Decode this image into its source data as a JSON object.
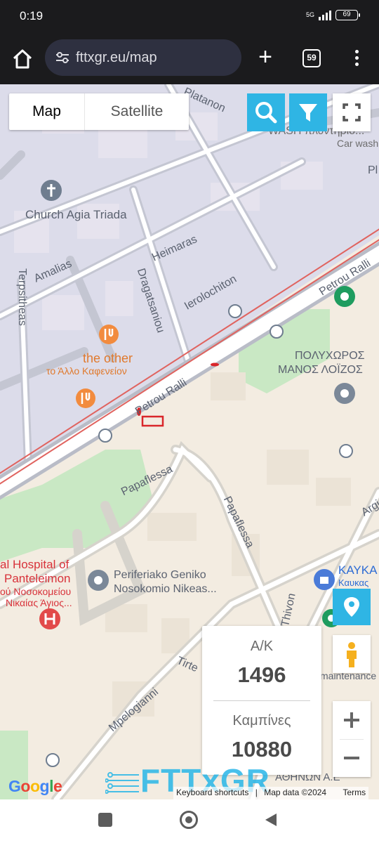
{
  "status_bar": {
    "time": "0:19",
    "network": "5G",
    "battery": "69"
  },
  "browser": {
    "url": "fttxgr.eu/map",
    "tab_count": "59"
  },
  "map_controls": {
    "map_label": "Map",
    "satellite_label": "Satellite"
  },
  "stats": {
    "ak_label": "Α/Κ",
    "ak_value": "1496",
    "cabinets_label": "Καμπίνες",
    "cabinets_value": "10880"
  },
  "attribution": {
    "google": "Google",
    "brand": "FTTxGR",
    "keyboard": "Keyboard shortcuts",
    "map_data": "Map data ©2024",
    "terms": "Terms"
  },
  "map_labels": {
    "platanon": "Platanon",
    "wash": "WASH πλυντηριο...",
    "car_wash": "Car wash",
    "church": "Church Agia Triada",
    "heimaras": "Heimaras",
    "amalias": "Amalias",
    "dragatsaniou": "Dragatsaniou",
    "ierolochiton": "Ierolochiton",
    "terpsitheas": "Terpsitheas",
    "petrou_ralli_1": "Petrou Ralli",
    "petrou_ralli_2": "Petrou Ralli",
    "the_other": "the other",
    "the_other_gr": "το Άλλο Καφενείον",
    "polychoros_1": "ΠΟΛΥΧΩΡΟΣ",
    "polychoros_2": "ΜΑΝΟΣ ΛΟΪΖΟΣ",
    "papaflessa_1": "Papaflessa",
    "papaflessa_2": "Papaflessa",
    "hospital_1": "al Hospital of",
    "hospital_2": "Panteleimon",
    "hospital_3": "ού Νοσοκομείου",
    "hospital_4": "Νικαίας Άγιος...",
    "periferiako_1": "Periferiako Geniko",
    "periferiako_2": "Nosokomio Nikeas...",
    "kaykas_1": "ΚΑΥΚΑ",
    "kaykas_2": "Καυκας",
    "thivon": "Thivon",
    "tirte": "Tirte",
    "mpelogianni": "Mpelogianni",
    "athinon": "ΑΘΗΝΩΝ Α.Ε",
    "maintenance": "maintenance",
    "argi": "Argi",
    "pl": "Pl"
  }
}
